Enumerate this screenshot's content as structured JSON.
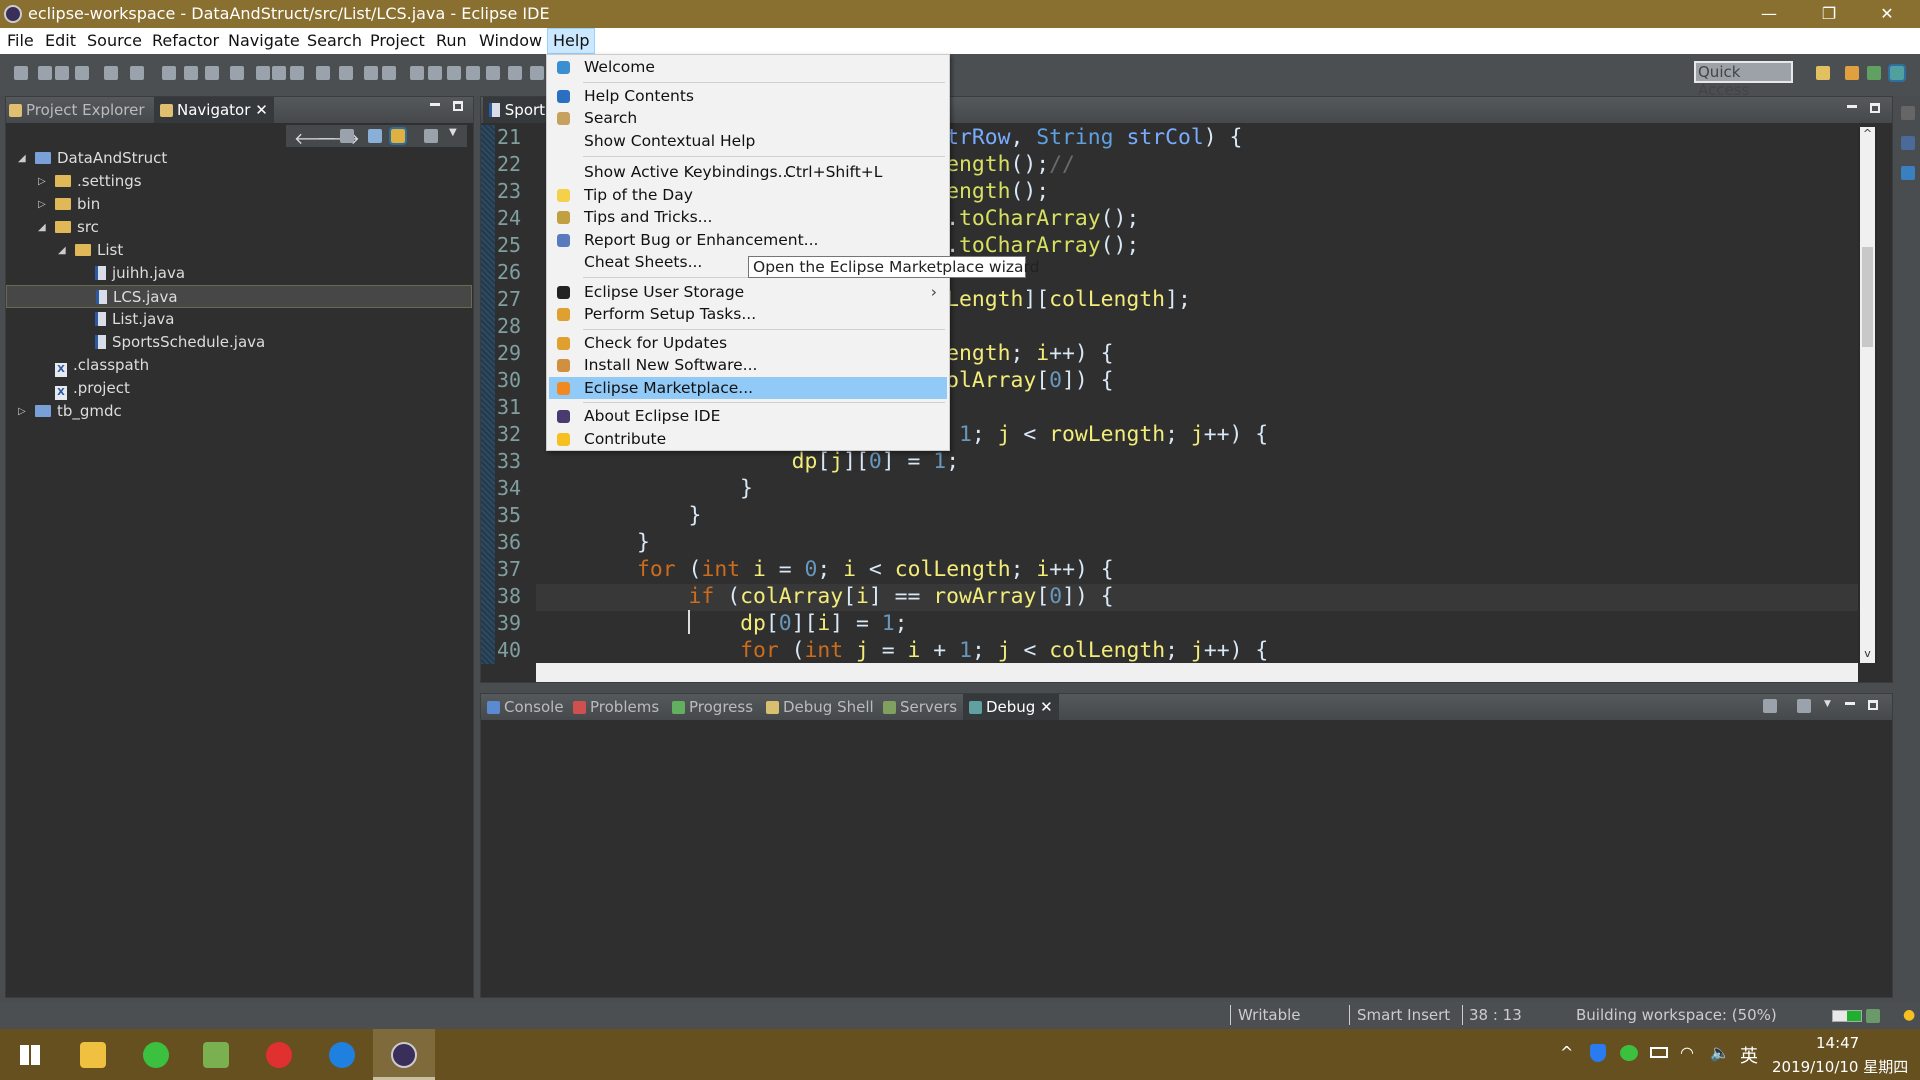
{
  "window": {
    "title": "eclipse-workspace - DataAndStruct/src/List/LCS.java - Eclipse IDE",
    "minimize": "—",
    "restore": "❐",
    "close": "✕"
  },
  "menubar": [
    "File",
    "Edit",
    "Source",
    "Refactor",
    "Navigate",
    "Search",
    "Project",
    "Run",
    "Window",
    "Help"
  ],
  "toolbar": {
    "quick_access": "Quick Access"
  },
  "left_panel": {
    "tabs": [
      "Project Explorer",
      "Navigator"
    ],
    "close": "✕",
    "tree": [
      {
        "label": "DataAndStruct",
        "level": 0,
        "expanded": true,
        "type": "project"
      },
      {
        "label": ".settings",
        "level": 1,
        "expanded": false,
        "type": "folder"
      },
      {
        "label": "bin",
        "level": 1,
        "expanded": false,
        "type": "folder"
      },
      {
        "label": "src",
        "level": 1,
        "expanded": true,
        "type": "folder"
      },
      {
        "label": "List",
        "level": 2,
        "expanded": true,
        "type": "folder"
      },
      {
        "label": "juihh.java",
        "level": 3,
        "type": "java"
      },
      {
        "label": "LCS.java",
        "level": 3,
        "type": "java",
        "selected": true
      },
      {
        "label": "List.java",
        "level": 3,
        "type": "java"
      },
      {
        "label": "SportsSchedule.java",
        "level": 3,
        "type": "java"
      },
      {
        "label": ".classpath",
        "level": 1,
        "type": "xml"
      },
      {
        "label": ".project",
        "level": 1,
        "type": "xml"
      },
      {
        "label": "tb_gmdc",
        "level": 0,
        "expanded": false,
        "type": "project"
      }
    ]
  },
  "editor": {
    "tab": "Sport",
    "first_line": 21,
    "current_line": 38,
    "lines": [
      [
        [
          "                                ",
          ""
        ],
        [
          "trRow",
          "p"
        ],
        [
          ", ",
          ""
        ],
        [
          "String",
          "ty"
        ],
        [
          " ",
          ""
        ],
        [
          "strCol",
          "p"
        ],
        [
          ") {",
          ""
        ]
      ],
      [
        [
          "                                ",
          ""
        ],
        [
          "ength",
          "m"
        ],
        [
          "();",
          ""
        ],
        [
          "//",
          "c"
        ]
      ],
      [
        [
          "                                ",
          ""
        ],
        [
          "ength",
          "m"
        ],
        [
          "();",
          ""
        ]
      ],
      [
        [
          "                                .",
          ""
        ],
        [
          "toCharArray",
          "m"
        ],
        [
          "();",
          ""
        ]
      ],
      [
        [
          "                                .",
          ""
        ],
        [
          "toCharArray",
          "m"
        ],
        [
          "();",
          ""
        ]
      ],
      [],
      [
        [
          "                                ",
          ""
        ],
        [
          "Length",
          "v"
        ],
        [
          "][",
          ""
        ],
        [
          "colLength",
          "v"
        ],
        [
          "];",
          ""
        ]
      ],
      [],
      [
        [
          "                                ",
          ""
        ],
        [
          "ength",
          "v"
        ],
        [
          "; ",
          ""
        ],
        [
          "i",
          "v"
        ],
        [
          "++) {",
          ""
        ]
      ],
      [
        [
          "                                ",
          ""
        ],
        [
          "olArray",
          "v"
        ],
        [
          "[",
          ""
        ],
        [
          "0",
          "n"
        ],
        [
          "]) {",
          ""
        ]
      ],
      [],
      [
        [
          "                                 ",
          ""
        ],
        [
          "1",
          "n"
        ],
        [
          "; ",
          ""
        ],
        [
          "j",
          "v"
        ],
        [
          " < ",
          ""
        ],
        [
          "rowLength",
          "v"
        ],
        [
          "; ",
          ""
        ],
        [
          "j",
          "v"
        ],
        [
          "++) {",
          ""
        ]
      ],
      [
        [
          "                    ",
          ""
        ],
        [
          "dp",
          "v"
        ],
        [
          "[",
          ""
        ],
        [
          "j",
          "v"
        ],
        [
          "][",
          ""
        ],
        [
          "0",
          "n"
        ],
        [
          "] = ",
          ""
        ],
        [
          "1",
          "n"
        ],
        [
          ";",
          ""
        ]
      ],
      [
        [
          "                }",
          ""
        ]
      ],
      [
        [
          "            }",
          ""
        ]
      ],
      [
        [
          "        }",
          ""
        ]
      ],
      [
        [
          "        ",
          ""
        ],
        [
          "for",
          "k"
        ],
        [
          " (",
          ""
        ],
        [
          "int",
          "k"
        ],
        [
          " ",
          ""
        ],
        [
          "i",
          "v"
        ],
        [
          " = ",
          ""
        ],
        [
          "0",
          "n"
        ],
        [
          "; ",
          ""
        ],
        [
          "i",
          "v"
        ],
        [
          " < ",
          ""
        ],
        [
          "colLength",
          "v"
        ],
        [
          "; ",
          ""
        ],
        [
          "i",
          "v"
        ],
        [
          "++) {",
          ""
        ]
      ],
      [
        [
          "            ",
          ""
        ],
        [
          "if",
          "k"
        ],
        [
          " (",
          ""
        ],
        [
          "colArray",
          "v"
        ],
        [
          "[",
          ""
        ],
        [
          "i",
          "v"
        ],
        [
          "] == ",
          ""
        ],
        [
          "rowArray",
          "v"
        ],
        [
          "[",
          ""
        ],
        [
          "0",
          "n"
        ],
        [
          "]) {",
          ""
        ]
      ],
      [
        [
          "                ",
          ""
        ],
        [
          "dp",
          "v"
        ],
        [
          "[",
          ""
        ],
        [
          "0",
          "n"
        ],
        [
          "][",
          ""
        ],
        [
          "i",
          "v"
        ],
        [
          "] = ",
          ""
        ],
        [
          "1",
          "n"
        ],
        [
          ";",
          ""
        ]
      ],
      [
        [
          "                ",
          ""
        ],
        [
          "for",
          "k"
        ],
        [
          " (",
          ""
        ],
        [
          "int",
          "k"
        ],
        [
          " ",
          ""
        ],
        [
          "j",
          "v"
        ],
        [
          " = ",
          ""
        ],
        [
          "i",
          "v"
        ],
        [
          " + ",
          ""
        ],
        [
          "1",
          "n"
        ],
        [
          "; ",
          ""
        ],
        [
          "j",
          "v"
        ],
        [
          " < ",
          ""
        ],
        [
          "colLength",
          "v"
        ],
        [
          "; ",
          ""
        ],
        [
          "j",
          "v"
        ],
        [
          "++) {",
          ""
        ]
      ]
    ]
  },
  "help_menu": {
    "items": [
      {
        "label": "Welcome",
        "icon": "welcome-icon",
        "color": "#3a8fd0"
      },
      {
        "sep": true
      },
      {
        "label": "Help Contents",
        "icon": "help-icon",
        "color": "#2a6fc0"
      },
      {
        "label": "Search",
        "icon": "search-icon",
        "color": "#c8a060"
      },
      {
        "label": "Show Contextual Help"
      },
      {
        "sep": true
      },
      {
        "label": "Show Active Keybindings...",
        "shortcut": "Ctrl+Shift+L"
      },
      {
        "label": "Tip of the Day",
        "icon": "lightbulb-icon",
        "color": "#f5d04a"
      },
      {
        "label": "Tips and Tricks...",
        "icon": "tips-icon",
        "color": "#c0a040"
      },
      {
        "label": "Report Bug or Enhancement...",
        "icon": "bug-icon",
        "color": "#5a7ac0"
      },
      {
        "label": "Cheat Sheets..."
      },
      {
        "sep": true
      },
      {
        "label": "Eclipse User Storage",
        "icon": "user-icon",
        "color": "#222222",
        "submenu": "›"
      },
      {
        "label": "Perform Setup Tasks...",
        "icon": "setup-icon",
        "color": "#e0a030"
      },
      {
        "sep": true
      },
      {
        "label": "Check for Updates",
        "icon": "update-icon",
        "color": "#e0a030"
      },
      {
        "label": "Install New Software...",
        "icon": "install-icon",
        "color": "#d09040"
      },
      {
        "label": "Eclipse Marketplace...",
        "icon": "marketplace-icon",
        "color": "#f08a20",
        "highlighted": true
      },
      {
        "sep": true
      },
      {
        "label": "About Eclipse IDE",
        "icon": "eclipse-icon",
        "color": "#4a3a70"
      },
      {
        "label": "Contribute",
        "icon": "star-icon",
        "color": "#f5c020"
      }
    ]
  },
  "tooltip": "Open the Eclipse Marketplace wizard",
  "bottom_panel": {
    "tabs": [
      "Console",
      "Problems",
      "Progress",
      "Debug Shell",
      "Servers",
      "Debug"
    ],
    "close": "✕"
  },
  "statusbar": {
    "writable": "Writable",
    "insert_mode": "Smart Insert",
    "position": "38 : 13",
    "task": "Building workspace: (50%)",
    "progress": 0.5
  },
  "taskbar": {
    "time": "14:47",
    "date": "2019/10/10 星期四",
    "ime": "英"
  },
  "colors": {
    "title_bar": "#8a7030",
    "taskbar": "#66501f",
    "editor_bg": "#2f2f2f",
    "menu_highlight": "#91c9f7"
  }
}
